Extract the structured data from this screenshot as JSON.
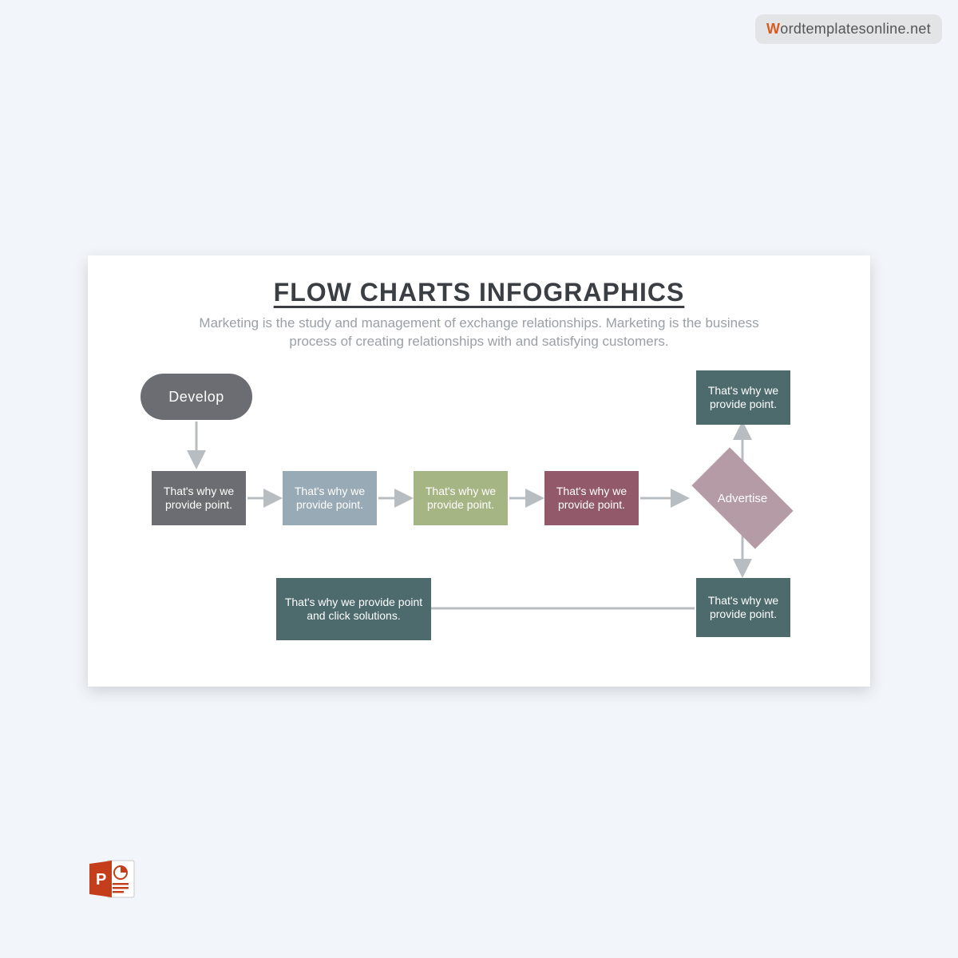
{
  "watermark": {
    "first_letter": "W",
    "rest": "ordtemplatesonline.net"
  },
  "slide": {
    "title": "FLOW CHARTS INFOGRAPHICS",
    "subtitle": "Marketing is the study and management of exchange relationships. Marketing is the business process of creating relationships with and satisfying customers."
  },
  "nodes": {
    "develop": "Develop",
    "box1": "That's why we provide point.",
    "box2": "That's why we provide point.",
    "box3": "That's why we provide point.",
    "box4": "That's why we provide point.",
    "advertise": "Advertise",
    "top_teal": "That's why we provide point.",
    "bottom_teal": "That's why we provide point.",
    "solutions": "That's why we provide point and click solutions."
  },
  "colors": {
    "gray": "#6c6d72",
    "blue": "#98aab5",
    "green": "#a6b584",
    "plum": "#92596b",
    "teal": "#4d6a6d",
    "mauve": "#b59ba6",
    "arrow": "#b8bdc2"
  },
  "icon": {
    "name": "powerpoint-icon"
  }
}
